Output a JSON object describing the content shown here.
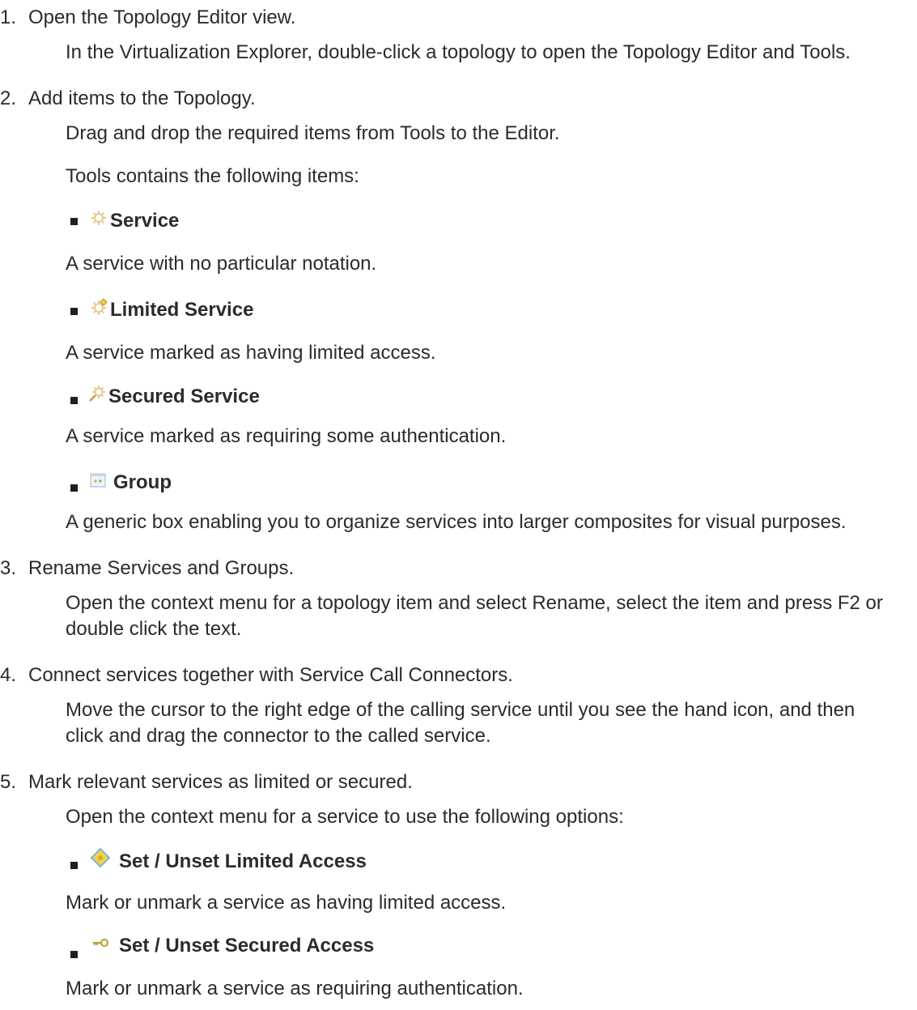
{
  "steps": [
    {
      "number": "1.",
      "title": "Open the Topology Editor view.",
      "text": "In the Virtualization Explorer, double-click a topology to open the Topology Editor and Tools."
    },
    {
      "number": "2.",
      "title": "Add items to the Topology.",
      "text": "Drag and drop the required items from Tools to the Editor.",
      "text2": "Tools contains the following items:",
      "items": [
        {
          "icon": "gear-icon",
          "label": "Service",
          "desc": "A service with no particular notation."
        },
        {
          "icon": "limited-gear-icon",
          "label": "Limited Service",
          "desc": "A service marked as having limited access."
        },
        {
          "icon": "secured-gear-icon",
          "label": "Secured Service",
          "desc": "A service marked as requiring some authentication."
        },
        {
          "icon": "group-icon",
          "label": "Group",
          "desc": "A generic box enabling you to organize services into larger composites for visual purposes."
        }
      ]
    },
    {
      "number": "3.",
      "title": "Rename Services and Groups.",
      "text": "Open the context menu for a topology item and select Rename, select the item and press F2 or double click the text."
    },
    {
      "number": "4.",
      "title": "Connect services together with Service Call Connectors.",
      "text": "Move the cursor to the right edge of the calling service until you see the hand icon, and then click and drag the connector to the called service."
    },
    {
      "number": "5.",
      "title": "Mark relevant services as limited or secured.",
      "text": "Open the context menu for a service to use the following options:",
      "items": [
        {
          "icon": "limited-access-diamond-icon",
          "label": "Set / Unset Limited Access",
          "desc": "Mark or unmark a service as having limited access."
        },
        {
          "icon": "key-icon",
          "label": "Set / Unset Secured Access",
          "desc": "Mark or unmark a service as requiring authentication."
        }
      ]
    }
  ],
  "colors": {
    "text": "#2b2b2b",
    "bullet": "#1f1f1f",
    "gear": "#e8c98a",
    "limited": "#f2d24a",
    "key": "#b99a2a"
  }
}
